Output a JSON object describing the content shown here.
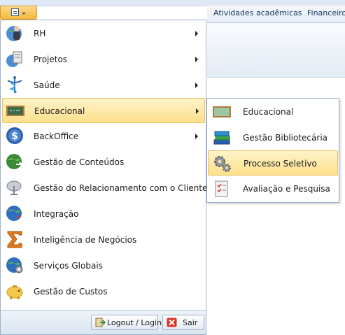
{
  "ribbon": {
    "tabs": [
      "Atividades acadêmicas",
      "Financeiro"
    ]
  },
  "app_menu": {
    "button_icon": "menu-list-icon",
    "items": [
      {
        "label": "RH",
        "icon": "person-globe-icon",
        "has_submenu": true
      },
      {
        "label": "Projetos",
        "icon": "projects-icon",
        "has_submenu": true
      },
      {
        "label": "Saúde",
        "icon": "caduceus-icon",
        "has_submenu": true
      },
      {
        "label": "Educacional",
        "icon": "chalkboard-icon",
        "has_submenu": true,
        "active": true
      },
      {
        "label": "BackOffice",
        "icon": "dollar-icon",
        "has_submenu": true
      },
      {
        "label": "Gestão de Conteúdos",
        "icon": "content-globe-icon",
        "has_submenu": false
      },
      {
        "label": "Gestão do Relacionamento com o Cliente",
        "icon": "satellite-dish-icon",
        "has_submenu": false
      },
      {
        "label": "Integração",
        "icon": "globe-arrow-icon",
        "has_submenu": false
      },
      {
        "label": "Inteligência de Negócios",
        "icon": "sigma-icon",
        "has_submenu": false
      },
      {
        "label": "Serviços Globais",
        "icon": "globe-gear-icon",
        "has_submenu": false
      },
      {
        "label": "Gestão de Custos",
        "icon": "piggy-bank-icon",
        "has_submenu": false
      }
    ],
    "footer": {
      "logout_label": "Logout / Login",
      "exit_label": "Sair"
    }
  },
  "submenu": {
    "items": [
      {
        "label": "Educacional",
        "icon": "chalkboard-icon"
      },
      {
        "label": "Gestão Bibliotecária",
        "icon": "books-icon"
      },
      {
        "label": "Processo Seletivo",
        "icon": "gears-icon",
        "active": true
      },
      {
        "label": "Avaliação e Pesquisa",
        "icon": "checklist-icon"
      }
    ]
  },
  "colors": {
    "highlight_top": "#fff3c8",
    "highlight_bottom": "#fde08c",
    "highlight_border": "#e5c365",
    "menu_border": "#9db1cc",
    "app_button": "#f5b73c"
  }
}
